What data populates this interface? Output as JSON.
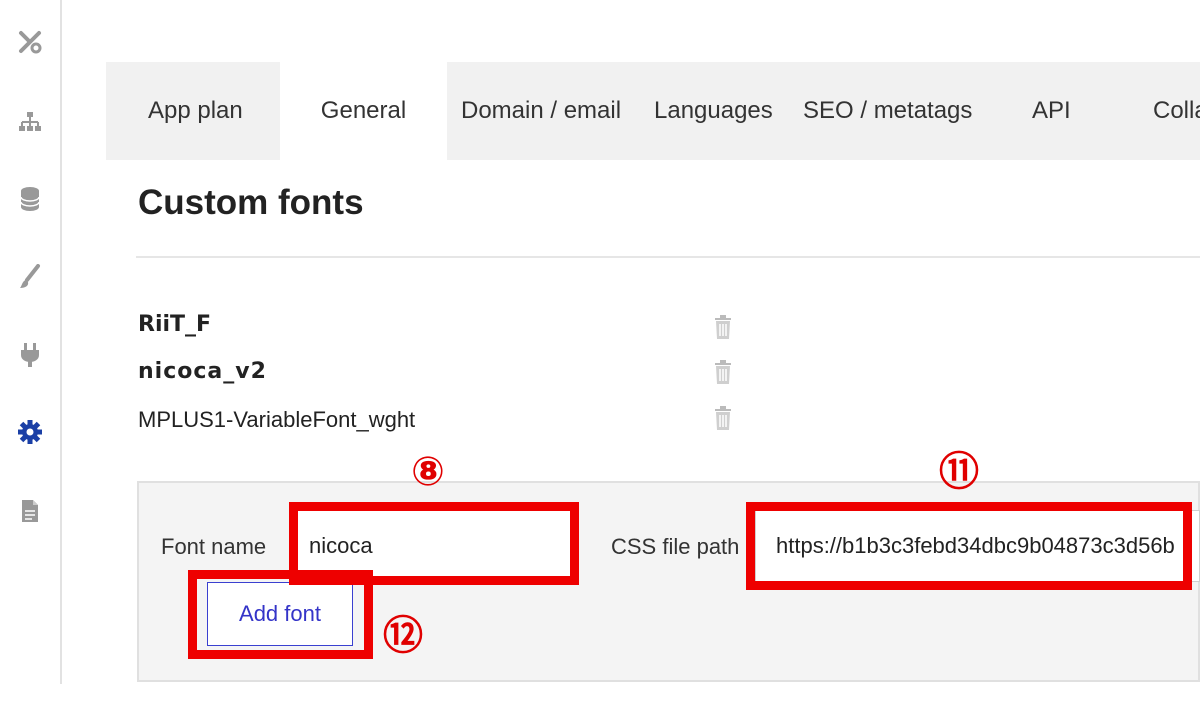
{
  "tabs": [
    {
      "label": "App plan"
    },
    {
      "label": "General"
    },
    {
      "label": "Domain / email"
    },
    {
      "label": "Languages"
    },
    {
      "label": "SEO / metatags"
    },
    {
      "label": "API"
    },
    {
      "label": "Colla"
    }
  ],
  "active_tab": "General",
  "section": {
    "title": "Custom fonts"
  },
  "fonts": [
    {
      "name": "RiiT_F"
    },
    {
      "name": "nicoca_v2"
    },
    {
      "name": "MPLUS1-VariableFont_wght"
    }
  ],
  "form": {
    "font_name_label": "Font name",
    "font_name_value": "nicoca",
    "css_path_label": "CSS file path",
    "css_path_value": "https://b1b3c3febd34dbc9b04873c3d56b",
    "add_button_label": "Add font"
  },
  "annotations": {
    "marker_8": "⑧",
    "marker_11": "⑪",
    "marker_12": "⑫"
  },
  "colors": {
    "highlight": "#ee0000",
    "active_icon": "#1a3fa6",
    "link": "#3434c8"
  },
  "icons": [
    "tools-icon",
    "sitemap-icon",
    "database-icon",
    "brush-icon",
    "plug-icon",
    "gear-icon",
    "file-icon"
  ]
}
